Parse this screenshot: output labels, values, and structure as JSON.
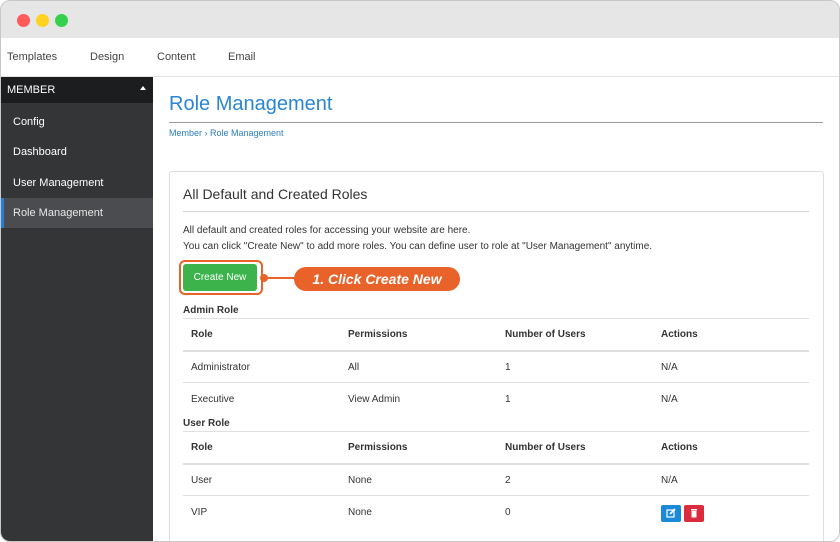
{
  "topnav": {
    "items": [
      "Templates",
      "Design",
      "Content",
      "Email"
    ]
  },
  "sidebar": {
    "header": "MEMBER",
    "items": [
      {
        "label": "Config"
      },
      {
        "label": "Dashboard"
      },
      {
        "label": "User Management"
      },
      {
        "label": "Role Management",
        "active": true
      }
    ]
  },
  "page": {
    "title": "Role Management",
    "breadcrumb": "Member › Role Management"
  },
  "panel": {
    "title": "All Default and Created Roles",
    "desc1": "All default and created roles for accessing your website are here.",
    "desc2": "You can click \"Create New\" to add more roles. You can define user to role at \"User Management\" anytime.",
    "create_label": "Create New",
    "callout": "1. Click Create New"
  },
  "admin_roles": {
    "section": "Admin Role",
    "headers": [
      "Role",
      "Permissions",
      "Number of Users",
      "Actions"
    ],
    "rows": [
      [
        "Administrator",
        "All",
        "1",
        "N/A"
      ],
      [
        "Executive",
        "View Admin",
        "1",
        "N/A"
      ]
    ]
  },
  "user_roles": {
    "section": "User Role",
    "headers": [
      "Role",
      "Permissions",
      "Number of Users",
      "Actions"
    ],
    "rows": [
      [
        "User",
        "None",
        "2",
        "N/A"
      ],
      [
        "VIP",
        "None",
        "0",
        ""
      ]
    ]
  },
  "colors": {
    "accent": "#2a86d4",
    "create_button": "#3cb44b",
    "callout": "#e8622a",
    "edit_button": "#1a8ad8",
    "delete_button": "#dd2b3e"
  },
  "icons": [
    "edit-icon",
    "trash-icon"
  ]
}
